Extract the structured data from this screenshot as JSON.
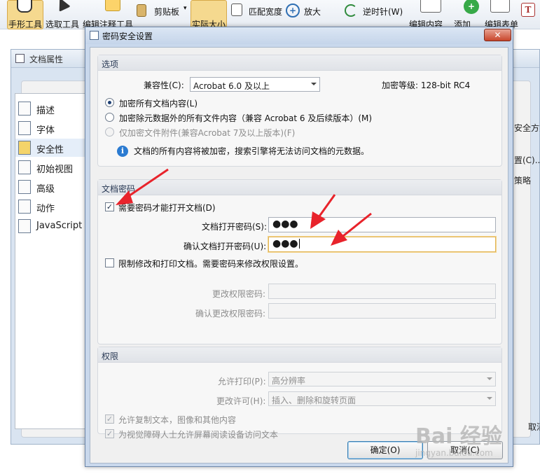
{
  "toolbar": {
    "hand_tool": "手形工具",
    "select_tool": "选取工具",
    "edit_annot_tool": "编辑注释工具",
    "clipboard": "剪贴板",
    "actual_size": "实际大小",
    "fit_width": "匹配宽度",
    "zoom_in": "放大",
    "rotate_ccw": "逆时针(W)",
    "edit_content": "编辑内容",
    "add": "添加",
    "edit_form": "编辑表单"
  },
  "props_window": {
    "title": "文档属性",
    "nav": [
      "描述",
      "字体",
      "安全性",
      "初始视图",
      "高级",
      "动作",
      "JavaScript"
    ],
    "right_fragments": [
      "安全方式",
      "置(C)...",
      "策略",
      "取消"
    ]
  },
  "dialog": {
    "title": "密码安全设置",
    "close_label": "✕",
    "options": {
      "heading": "选项",
      "compat_label": "兼容性(C):",
      "compat_value": "Acrobat 6.0 及以上",
      "encrypt_level": "加密等级: 128-bit RC4",
      "radio_all": "加密所有文档内容(L)",
      "radio_except_meta": "加密除元数据外的所有文件内容（兼容 Acrobat 6 及后续版本）(M)",
      "radio_attachments": "仅加密文件附件(兼容Acrobat 7及以上版本)(F)",
      "info": "文档的所有内容将被加密，搜索引擎将无法访问文档的元数据。"
    },
    "doc_password": {
      "heading": "文档密码",
      "require_open": "需要密码才能打开文档(D)",
      "open_pwd_label": "文档打开密码(S):",
      "open_pwd_value": "●●●",
      "confirm_pwd_label": "确认文档打开密码(U):",
      "confirm_pwd_value": "●●●",
      "restrict_edit": "限制修改和打印文档。需要密码来修改权限设置。",
      "perm_pwd_label": "更改权限密码:",
      "confirm_perm_pwd_label": "确认更改权限密码:"
    },
    "permissions": {
      "heading": "权限",
      "print_label": "允许打印(P):",
      "print_value": "高分辨率",
      "change_label": "更改许可(H):",
      "change_value": "插入、删除和旋转页面",
      "allow_copy": "允许复制文本，图像和其他内容",
      "allow_screen_reader": "为视觉障碍人士允许屏幕阅读设备访问文本"
    },
    "ok": "确定(O)",
    "cancel": "取消(C)"
  },
  "watermark": {
    "brand": "Bai 经验",
    "url": "jingyan.baidu.com"
  },
  "colors": {
    "arrow": "#e8232b",
    "selection": "#1d3f73",
    "info": "#2b7bd1"
  }
}
